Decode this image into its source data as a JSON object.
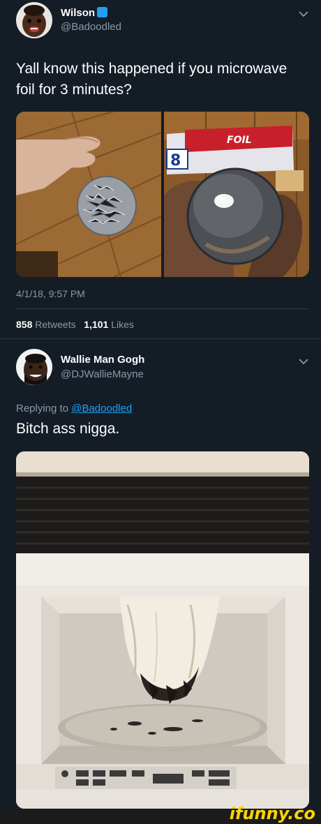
{
  "tweet1": {
    "display_name": "Wilson",
    "handle": "@Badoodled",
    "text_line1": "Yall know this happened if you microwave",
    "text_line2": "foil for 3 minutes?",
    "timestamp": "4/1/18, 9:57 PM",
    "retweets_count": "858",
    "retweets_label": "Retweets",
    "likes_count": "1,101",
    "likes_label": "Likes",
    "foil_box_text": "FOIL",
    "foil_box_number": "8"
  },
  "tweet2": {
    "display_name": "Wallie Man Gogh",
    "handle": "@DJWallieMayne",
    "replying_prefix": "Replying to",
    "replying_handle": "@Badoodled",
    "text": "Bitch ass nigga."
  },
  "watermark": "ifunny.co",
  "colors": {
    "background": "#141d26",
    "secondary_text": "#8899a6",
    "link": "#1da1f2",
    "watermark": "#ffd400"
  }
}
